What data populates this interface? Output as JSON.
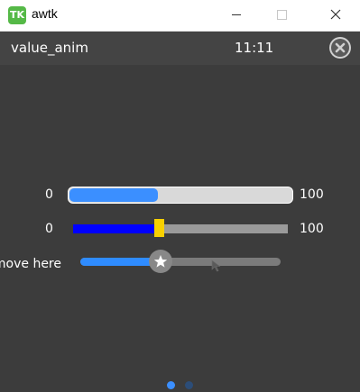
{
  "window": {
    "title": "awtk",
    "logo_text": "TK",
    "logo_color": "#55b947"
  },
  "header": {
    "title": "value_anim",
    "time": "11:11",
    "close_icon": "close-circle-icon"
  },
  "slider1": {
    "min": "0",
    "max": "100",
    "value": 40,
    "fill_color": "#3b8fff"
  },
  "slider2": {
    "min": "0",
    "max": "100",
    "value": 40,
    "fill_color": "#0000ff",
    "thumb_color": "#f8d000"
  },
  "slider3": {
    "label": "move here:",
    "value": 40,
    "fill_color": "#2f8cff",
    "thumb_icon": "star-icon"
  },
  "pager": {
    "count": 2,
    "active_index": 0
  }
}
